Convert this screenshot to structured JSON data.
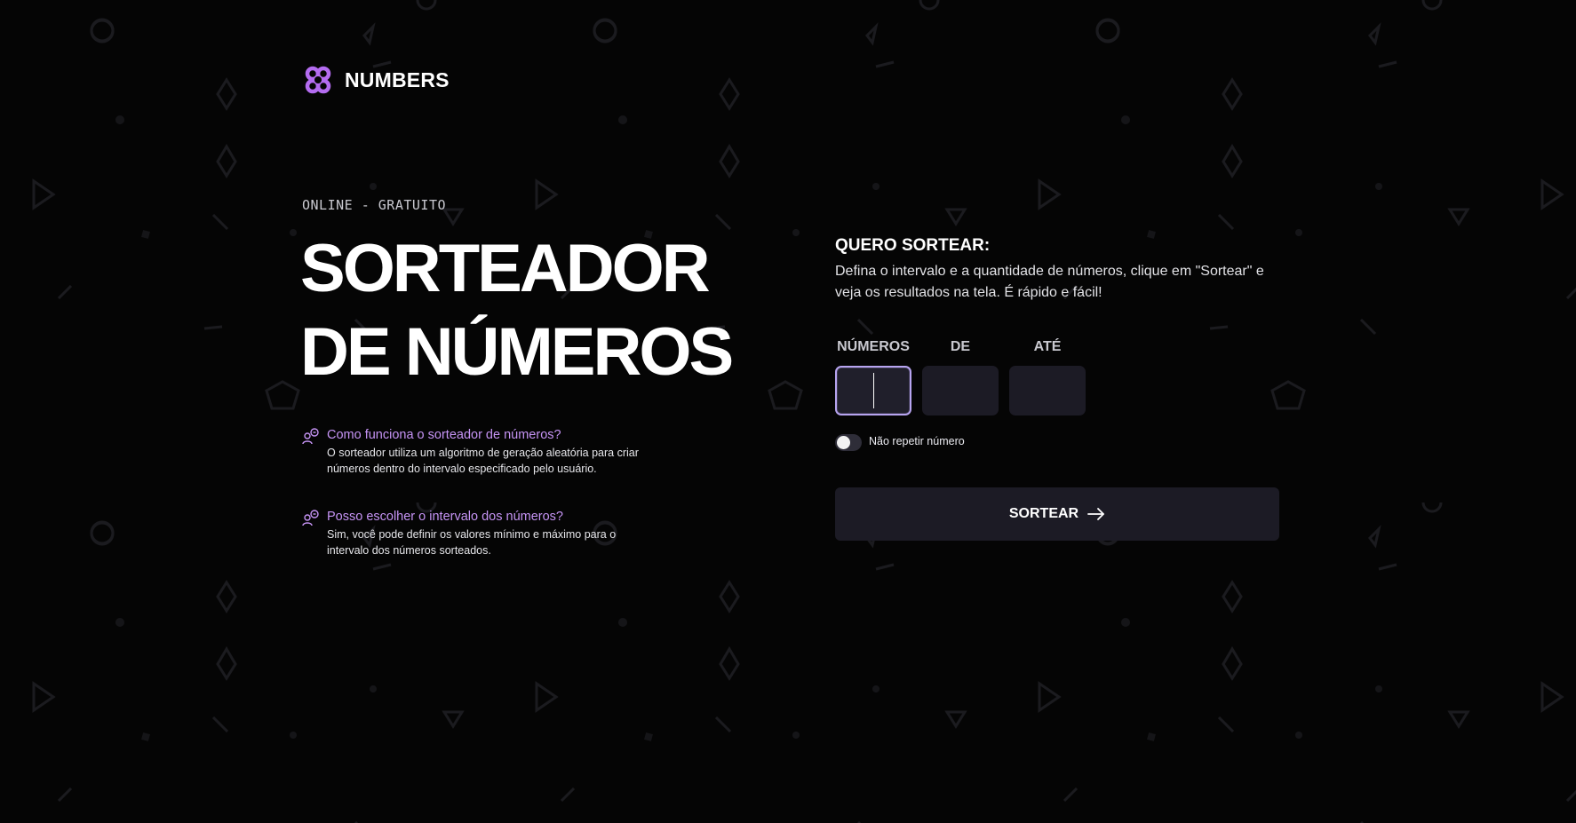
{
  "brand": {
    "name": "NUMBERS",
    "logo_icon": "petal-knot-icon",
    "accent_color": "#b46cf0"
  },
  "hero": {
    "eyebrow": "ONLINE - GRATUITO",
    "title_line1": "SORTEADOR",
    "title_line2": "DE NÚMEROS"
  },
  "faq": [
    {
      "icon": "chat-people-icon",
      "question": "Como funciona o sorteador de números?",
      "answer": "O sorteador utiliza um algoritmo de geração aleatória para criar números dentro do intervalo especificado pelo usuário."
    },
    {
      "icon": "chat-people-icon",
      "question": "Posso escolher o intervalo dos números?",
      "answer": "Sim, você pode definir os valores mínimo e máximo para o intervalo dos números sorteados."
    }
  ],
  "form": {
    "title": "QUERO SORTEAR:",
    "description": "Defina o intervalo e a quantidade de números, clique em \"Sortear\" e veja os resultados na tela. É rápido e fácil!",
    "fields": [
      {
        "label": "NÚMEROS",
        "value": ""
      },
      {
        "label": "DE",
        "value": ""
      },
      {
        "label": "ATÉ",
        "value": ""
      }
    ],
    "no_repeat": {
      "label": "Não repetir número",
      "checked": false
    },
    "submit_label": "SORTEAR",
    "submit_icon": "arrow-right-icon"
  }
}
